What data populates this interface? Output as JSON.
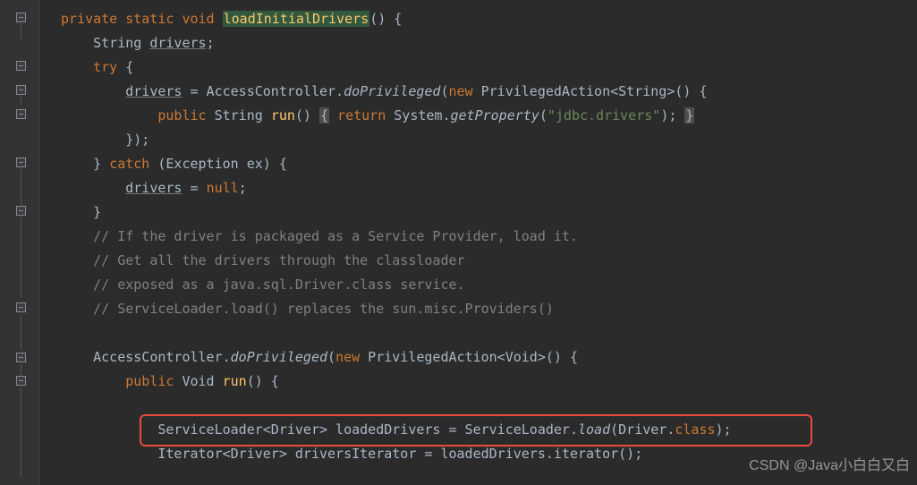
{
  "code": {
    "line1": {
      "kw1": "private",
      "kw2": "static",
      "kw3": "void",
      "method": "loadInitialDrivers",
      "parens": "() {"
    },
    "line2": {
      "type": "String ",
      "var": "drivers",
      "semi": ";"
    },
    "line3": {
      "kw": "try",
      "brace": " {"
    },
    "line4": {
      "var": "drivers",
      "eq": " = AccessController.",
      "call": "doPrivileged",
      "open": "(",
      "kw_new": "new",
      "type": " PrivilegedAction<String>() {"
    },
    "line5": {
      "kw1": "public",
      "type": " String ",
      "method": "run",
      "parens": "() ",
      "brace1": "{",
      "kw_ret": " return",
      "sys": " System.",
      "call": "getProperty",
      "open": "(",
      "str": "\"jdbc.drivers\"",
      "close": "); ",
      "brace2": "}"
    },
    "line6": "});",
    "line7": {
      "brace": "} ",
      "kw": "catch",
      "rest": " (Exception ex) {"
    },
    "line8": {
      "var": "drivers",
      "rest": " = ",
      "kw_null": "null",
      "semi": ";"
    },
    "line9": "}",
    "comment1": "// If the driver is packaged as a Service Provider, load it.",
    "comment2": "// Get all the drivers through the classloader",
    "comment3": "// exposed as a java.sql.Driver.class service.",
    "comment4": "// ServiceLoader.load() replaces the sun.misc.Providers()",
    "line15": {
      "cls": "AccessController.",
      "call": "doPrivileged",
      "open": "(",
      "kw_new": "new",
      "rest": " PrivilegedAction<Void>() {"
    },
    "line16": {
      "kw": "public",
      "type": " Void ",
      "method": "run",
      "rest": "() {"
    },
    "line18": {
      "type1": "ServiceLoader<Driver> loadedDrivers = ServiceLoader.",
      "call": "load",
      "open": "(Driver.",
      "kw_class": "class",
      "close": ");"
    },
    "line19": {
      "text": "Iterator<Driver> driversIterator = loadedDrivers.iterator();"
    }
  },
  "watermark": "CSDN @Java小白白又白"
}
